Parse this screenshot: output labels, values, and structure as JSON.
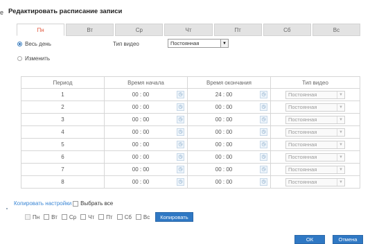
{
  "header": {
    "title_fragment": "e",
    "title": "Редактировать расписание записи"
  },
  "tabs": [
    {
      "label": "Пн",
      "active": true
    },
    {
      "label": "Вт",
      "active": false
    },
    {
      "label": "Ср",
      "active": false
    },
    {
      "label": "Чт",
      "active": false
    },
    {
      "label": "Пт",
      "active": false
    },
    {
      "label": "Сб",
      "active": false
    },
    {
      "label": "Вс",
      "active": false
    }
  ],
  "mode": {
    "all_day_label": "Весь день",
    "edit_label": "Изменить",
    "selected": "all_day",
    "video_type_label": "Тип видео",
    "video_type_value": "Постоянная"
  },
  "table": {
    "headers": {
      "period": "Период",
      "start": "Время начала",
      "end": "Время окончания",
      "type": "Тип видео"
    },
    "rows": [
      {
        "period": "1",
        "start": "00 : 00",
        "end": "24 : 00",
        "type": "Постоянная"
      },
      {
        "period": "2",
        "start": "00 : 00",
        "end": "00 : 00",
        "type": "Постоянная"
      },
      {
        "period": "3",
        "start": "00 : 00",
        "end": "00 : 00",
        "type": "Постоянная"
      },
      {
        "period": "4",
        "start": "00 : 00",
        "end": "00 : 00",
        "type": "Постоянная"
      },
      {
        "period": "5",
        "start": "00 : 00",
        "end": "00 : 00",
        "type": "Постоянная"
      },
      {
        "period": "6",
        "start": "00 : 00",
        "end": "00 : 00",
        "type": "Постоянная"
      },
      {
        "period": "7",
        "start": "00 : 00",
        "end": "00 : 00",
        "type": "Постоянная"
      },
      {
        "period": "8",
        "start": "00 : 00",
        "end": "00 : 00",
        "type": "Постоянная"
      }
    ]
  },
  "copy": {
    "link_label": "Копировать настройки",
    "select_all_label": "Выбрать все",
    "days": [
      {
        "label": "Пн",
        "checked": true,
        "disabled": true
      },
      {
        "label": "Вт",
        "checked": false,
        "disabled": false
      },
      {
        "label": "Ср",
        "checked": false,
        "disabled": false
      },
      {
        "label": "Чт",
        "checked": false,
        "disabled": false
      },
      {
        "label": "Пт",
        "checked": false,
        "disabled": false
      },
      {
        "label": "Сб",
        "checked": false,
        "disabled": false
      },
      {
        "label": "Вс",
        "checked": false,
        "disabled": false
      }
    ],
    "copy_button_label": "Копировать"
  },
  "footer": {
    "ok_label": "ОК",
    "cancel_label": "Отмена"
  },
  "icons": {
    "clock": "clock-icon",
    "dropdown": "chevron-down-icon"
  },
  "colors": {
    "accent": "#2f78c4",
    "active_tab_text": "#e0553b",
    "link": "#3a86d4"
  }
}
